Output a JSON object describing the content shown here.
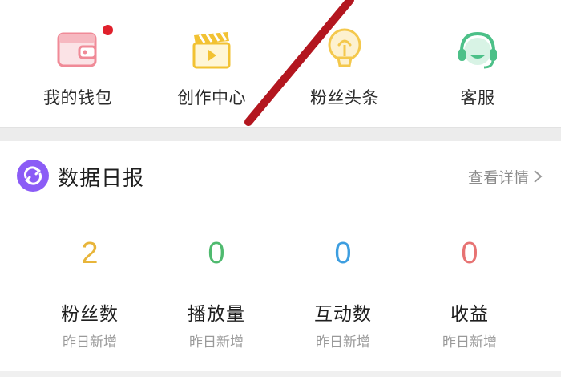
{
  "quick_actions": [
    {
      "label": "我的钱包",
      "icon": "wallet-icon",
      "has_badge": true
    },
    {
      "label": "创作中心",
      "icon": "clapperboard-icon",
      "has_badge": false
    },
    {
      "label": "粉丝头条",
      "icon": "lightbulb-icon",
      "has_badge": false
    },
    {
      "label": "客服",
      "icon": "headset-icon",
      "has_badge": false
    }
  ],
  "daily_report": {
    "title": "数据日报",
    "more_label": "查看详情",
    "stats": [
      {
        "value": "2",
        "label": "粉丝数",
        "sub": "昨日新增",
        "color": "#e8b53a"
      },
      {
        "value": "0",
        "label": "播放量",
        "sub": "昨日新增",
        "color": "#4fba6f"
      },
      {
        "value": "0",
        "label": "互动数",
        "sub": "昨日新增",
        "color": "#3d9ee0"
      },
      {
        "value": "0",
        "label": "收益",
        "sub": "昨日新增",
        "color": "#e77373"
      }
    ]
  },
  "colors": {
    "accent_purple": "#8b5cf6",
    "badge_red": "#e0202c",
    "wallet_pink": "#f08a97",
    "clapper_yellow": "#f2c233",
    "bulb_yellow": "#f4c84c",
    "service_green": "#4cc088"
  }
}
